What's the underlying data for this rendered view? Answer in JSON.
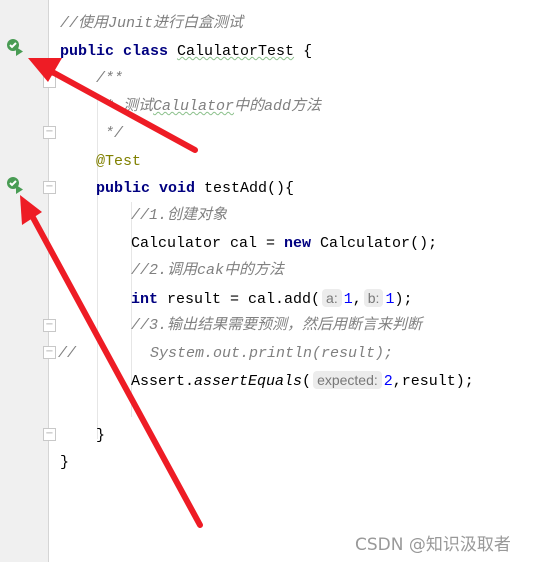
{
  "code": {
    "l1": "//使用Junit进行白盒测试",
    "l2_kw": "public class ",
    "l2_name": "CalulatorTest",
    " l2_end": " {",
    "l3": "/**",
    "l4a": " * 测试",
    "l4b": "Calulator",
    "l4c": "中的add方法",
    "l5": " */",
    "l6": "@Test",
    "l7_kw": "public void ",
    "l7_rest": "testAdd(){",
    "l8": "//1.创建对象",
    "l9a": "Calculator cal = ",
    "l9_kw": "new",
    "l9b": " Calculator();",
    "l10": "//2.调用cak中的方法",
    "l11_kw": "int",
    "l11a": " result = cal.add(",
    "hint_a": "a:",
    "v1": "1",
    ",": ",",
    "hint_b": "b:",
    "v2": "1",
    "l11b": ");",
    "l12": "//3.输出结果需要预测，然后用断言来判断",
    "l13a": "//",
    "l13b": "System.out.println(result);",
    "l14a": "Assert.",
    "l14b": "assertEquals",
    "l14c": "(",
    "hint_expected": "expected:",
    "v3": "2",
    "l14d": ",result);",
    "l16": "}",
    "l17": "}"
  },
  "l2_end": " {",
  "icons": {
    "run_class": "run-test-icon",
    "run_method": "run-test-icon",
    "annotation": "red-arrow"
  },
  "watermark": "CSDN @知识汲取者",
  "colors": {
    "keyword": "#000080",
    "comment": "#808080",
    "annotation": "#808000",
    "number": "#0000ff",
    "arrow": "#ee1c25",
    "run": "#499c54"
  }
}
